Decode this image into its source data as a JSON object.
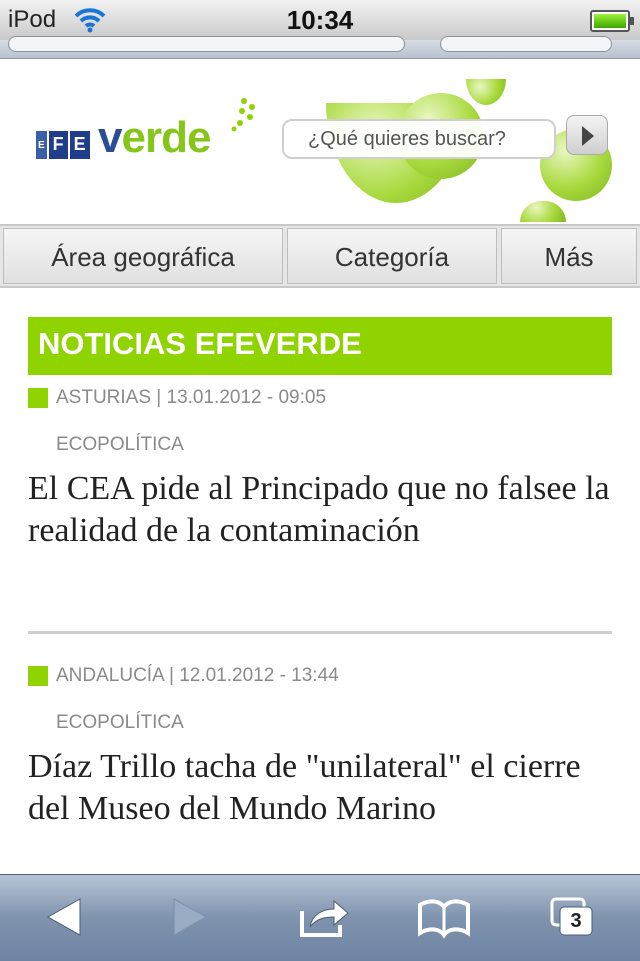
{
  "status_bar": {
    "carrier": "iPod",
    "time": "10:34"
  },
  "search": {
    "placeholder": "¿Qué quieres buscar?"
  },
  "nav": {
    "tabs": [
      {
        "label": "Área geográfica"
      },
      {
        "label": "Categoría"
      },
      {
        "label": "Más"
      }
    ]
  },
  "section": {
    "title": "NOTICIAS EFEVERDE"
  },
  "articles": [
    {
      "meta": "ASTURIAS | 13.01.2012 - 09:05",
      "category": "ECOPOLÍTICA",
      "headline": "El CEA pide al Principado que no falsee la realidad de la contaminación"
    },
    {
      "meta": "ANDALUCÍA | 12.01.2012 - 13:44",
      "category": "ECOPOLÍTICA",
      "headline": "Díaz Trillo tacha de \"unilateral\" el cierre del Museo del Mundo Marino"
    }
  ],
  "toolbar": {
    "tabs_count": "3"
  },
  "colors": {
    "accent_green": "#8fd400",
    "logo_blue": "#2a4d96",
    "logo_green": "#86c61a"
  },
  "icons": [
    "wifi-icon",
    "battery-icon",
    "search-go-icon",
    "back-icon",
    "forward-icon",
    "share-icon",
    "bookmarks-icon",
    "tabs-icon"
  ]
}
